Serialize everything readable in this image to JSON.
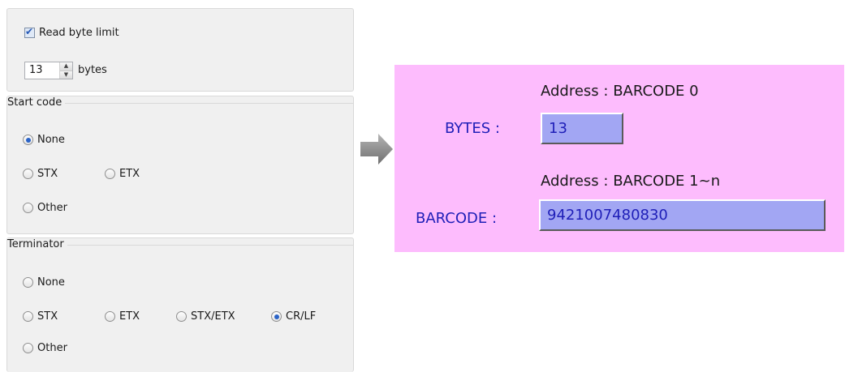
{
  "read_limit": {
    "checkbox_label": "Read byte limit",
    "checked": true,
    "bytes_value": "13",
    "bytes_unit": "bytes"
  },
  "start_code": {
    "title": "Start code",
    "options": [
      "None",
      "STX",
      "ETX",
      "Other"
    ],
    "selected": "None"
  },
  "terminator": {
    "title": "Terminator",
    "options": [
      "None",
      "STX",
      "ETX",
      "STX/ETX",
      "CR/LF",
      "Other"
    ],
    "selected": "CR/LF"
  },
  "display": {
    "bytes_address": "Address : BARCODE 0",
    "bytes_label": "BYTES :",
    "bytes_value": "13",
    "barcode_address": "Address : BARCODE 1~n",
    "barcode_label": "BARCODE :",
    "barcode_value": "9421007480830",
    "background_color": "#fdbcfd",
    "value_box_color": "#a2a6f3",
    "label_color": "#1f1fb8"
  },
  "icons": [
    "checkbox-icon",
    "spinner-up-icon",
    "spinner-down-icon",
    "radio-icon",
    "right-arrow-icon"
  ]
}
